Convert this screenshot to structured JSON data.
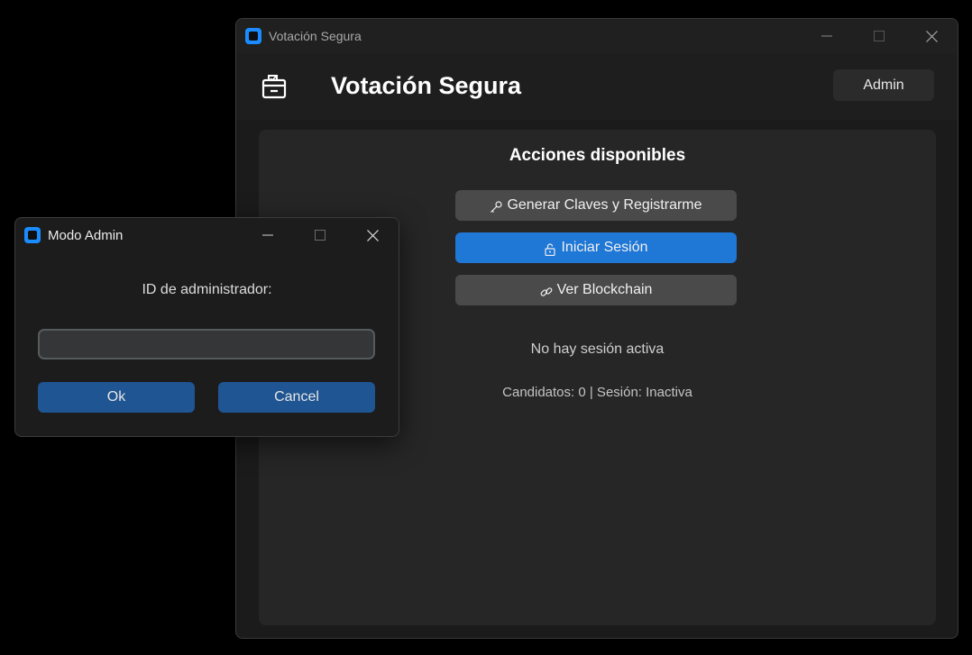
{
  "main_window": {
    "title": "Votación Segura",
    "header": {
      "heading": "Votación Segura",
      "admin_button_label": "Admin"
    },
    "panel": {
      "title": "Acciones disponibles",
      "actions": [
        {
          "label": "Generar Claves y Registrarme",
          "icon": "key-icon",
          "style": "gray"
        },
        {
          "label": "Iniciar Sesión",
          "icon": "unlock-icon",
          "style": "blue"
        },
        {
          "label": "Ver Blockchain",
          "icon": "link-icon",
          "style": "gray"
        }
      ],
      "status": "No hay sesión activa",
      "info": "Candidatos: 0 | Sesión: Inactiva"
    }
  },
  "dialog": {
    "title": "Modo Admin",
    "label": "ID de administrador:",
    "input_value": "",
    "ok_label": "Ok",
    "cancel_label": "Cancel"
  },
  "colors": {
    "accent_blue": "#1f77d6",
    "dialog_button": "#1f5592",
    "app_icon": "#1a8cff"
  }
}
